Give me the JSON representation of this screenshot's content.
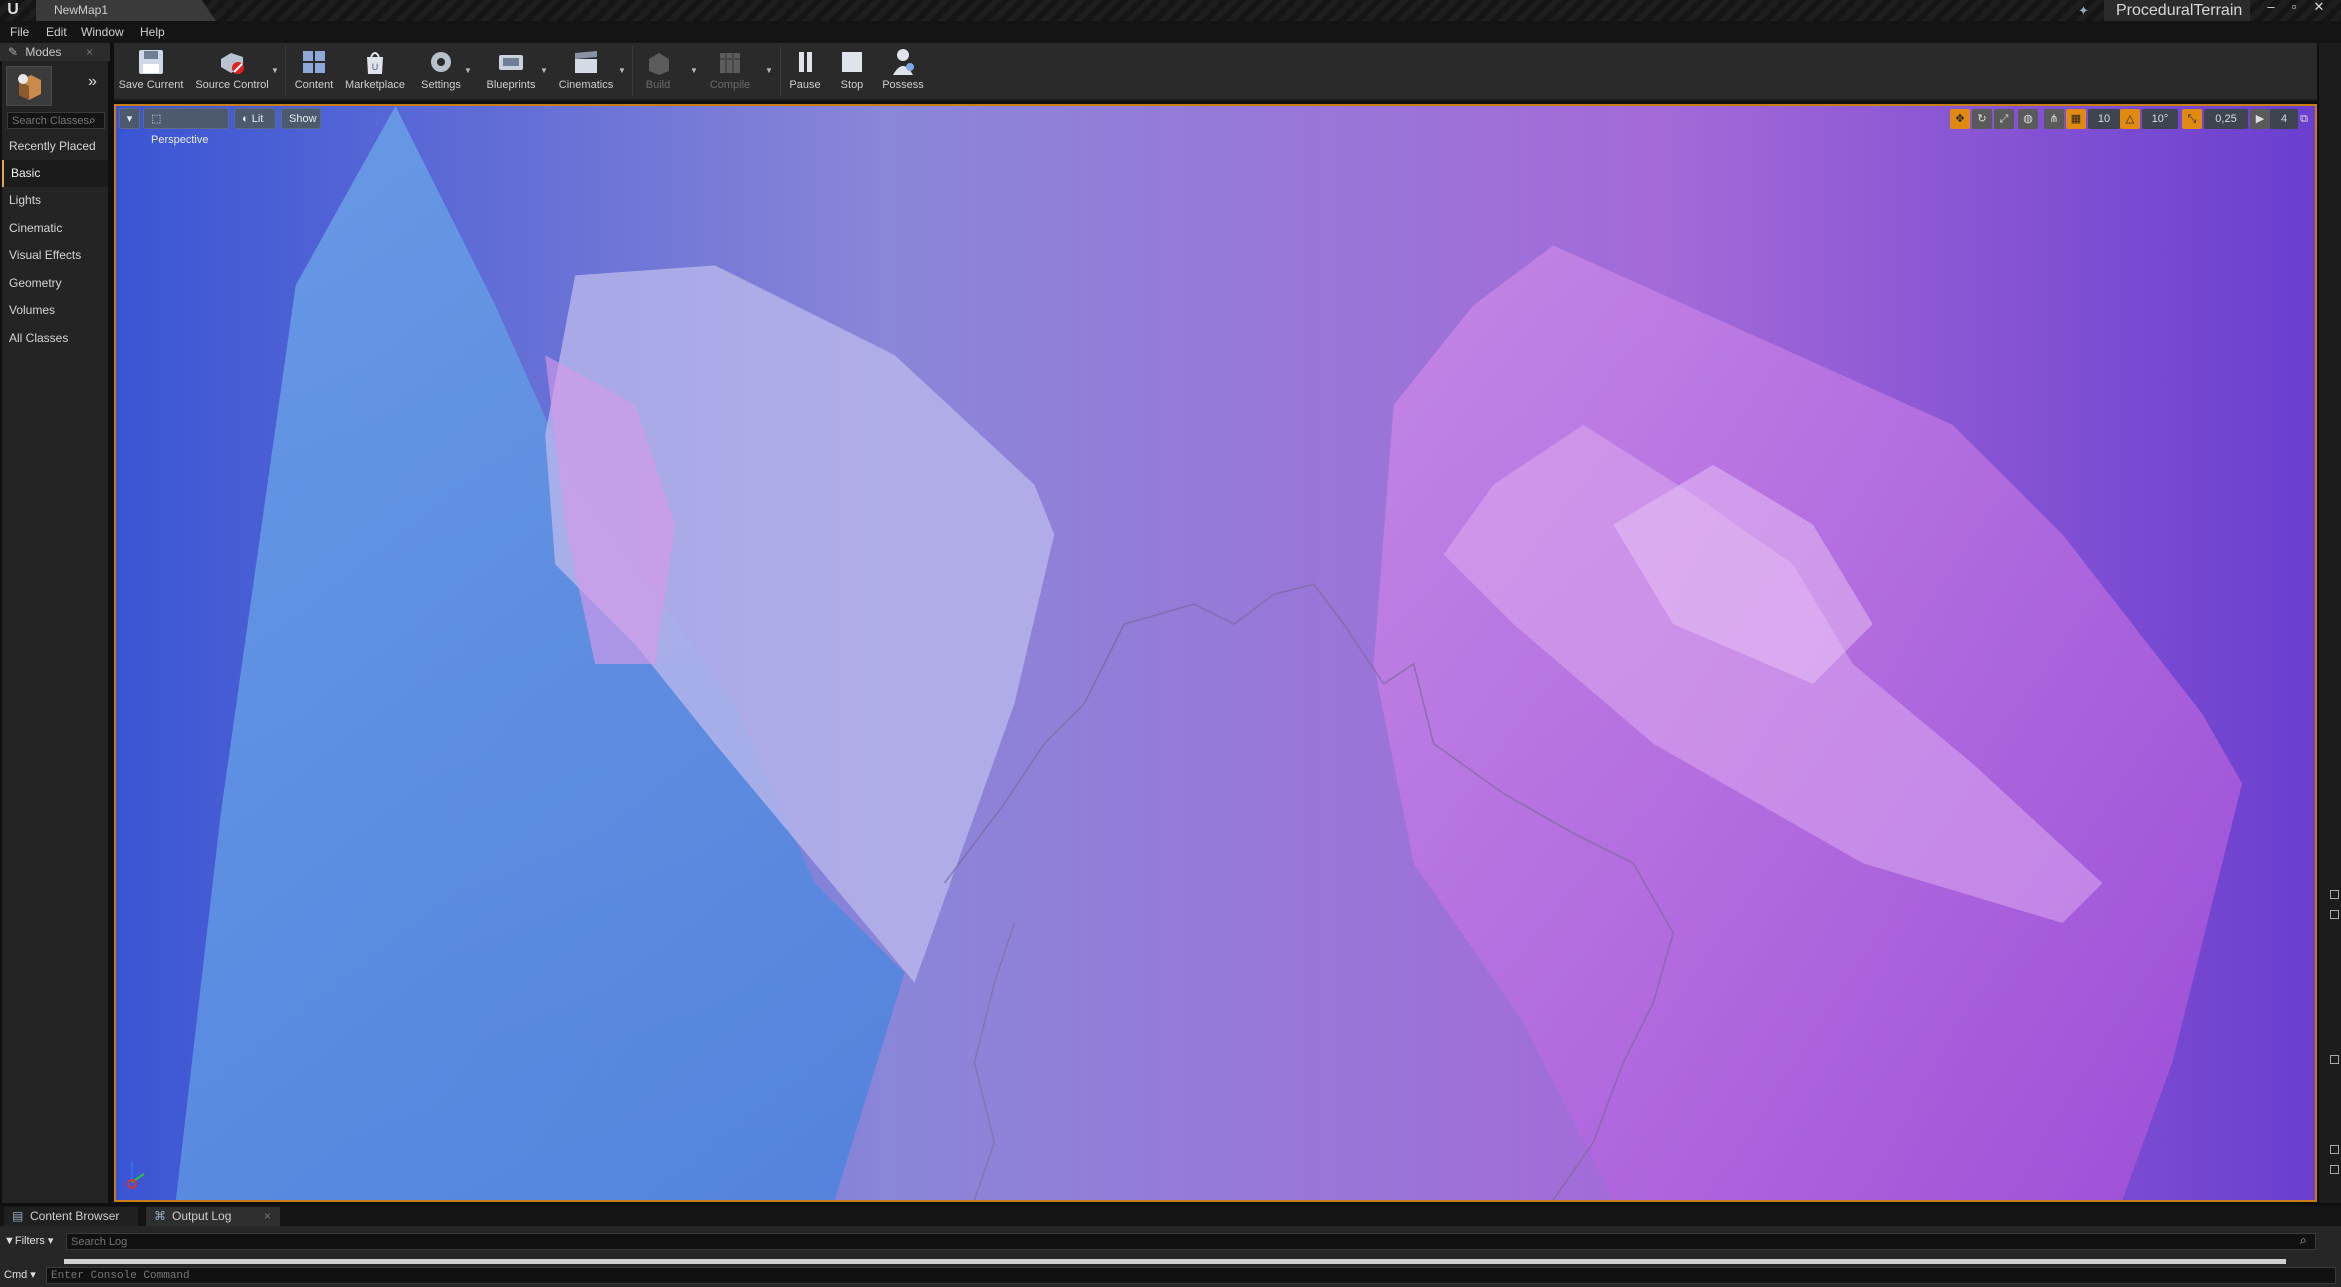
{
  "window": {
    "document_tab": "NewMap1",
    "project_name": "ProceduralTerrain",
    "controls": [
      "–",
      "▫",
      "✕"
    ]
  },
  "menu": [
    "File",
    "Edit",
    "Window",
    "Help"
  ],
  "modes": {
    "tab_label": "Modes",
    "search_placeholder": "Search Classes",
    "categories": [
      "Recently Placed",
      "Basic",
      "Lights",
      "Cinematic",
      "Visual Effects",
      "Geometry",
      "Volumes",
      "All Classes"
    ],
    "active_category": "Basic"
  },
  "toolbar": {
    "save": "Save Current",
    "source_control": "Source Control",
    "content": "Content",
    "marketplace": "Marketplace",
    "settings": "Settings",
    "blueprints": "Blueprints",
    "cinematics": "Cinematics",
    "build": "Build",
    "compile": "Compile",
    "pause": "Pause",
    "stop": "Stop",
    "possess": "Possess"
  },
  "viewport": {
    "view_mode": "Perspective",
    "lighting": "Lit",
    "show": "Show",
    "grid_snap": "10",
    "rotation_snap": "10°",
    "scale_snap": "0,25",
    "camera_speed": "4",
    "accent_color": "#c97d17"
  },
  "bottom": {
    "tabs": [
      "Content Browser",
      "Output Log"
    ],
    "filters": "Filters",
    "search_log_placeholder": "Search Log",
    "cmd": "Cmd",
    "console_placeholder": "Enter Console Command"
  }
}
